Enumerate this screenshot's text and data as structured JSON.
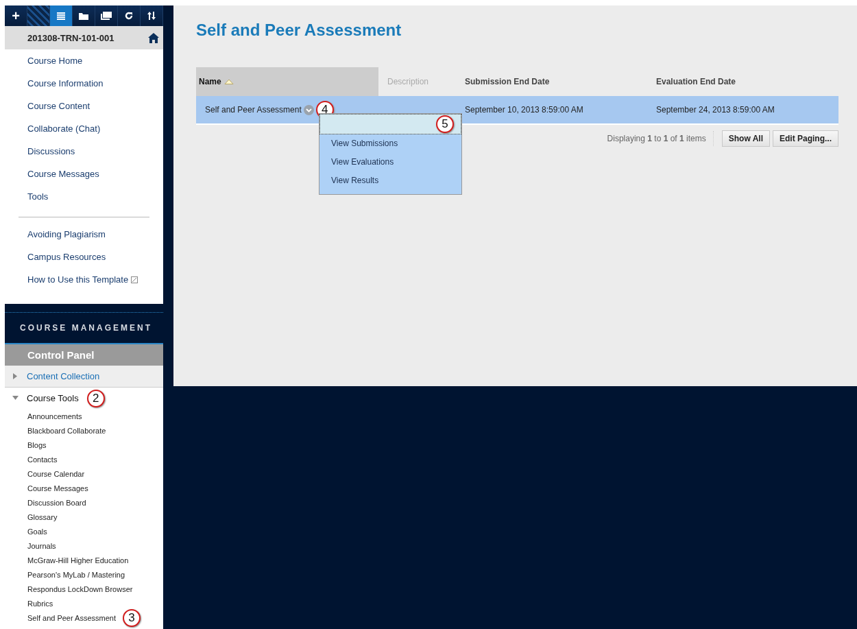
{
  "toolbar": [
    {
      "kind": "plus",
      "label": "+",
      "selected": false
    },
    {
      "kind": "pattern",
      "selected": false
    },
    {
      "kind": "list",
      "selected": true
    },
    {
      "kind": "folder",
      "selected": false
    },
    {
      "kind": "windows",
      "selected": false
    },
    {
      "kind": "refresh",
      "selected": false
    },
    {
      "kind": "sort",
      "selected": false
    }
  ],
  "course": {
    "title": "201308-TRN-101-001"
  },
  "menu": [
    {
      "label": "Course Home"
    },
    {
      "label": "Course Information"
    },
    {
      "label": "Course Content"
    },
    {
      "label": "Collaborate (Chat)"
    },
    {
      "label": "Discussions"
    },
    {
      "label": "Course Messages"
    },
    {
      "label": "Tools"
    }
  ],
  "extra_links": [
    {
      "label": "Avoiding Plagiarism",
      "external": false
    },
    {
      "label": "Campus Resources",
      "external": false
    },
    {
      "label": "How to Use this Template",
      "external": true
    }
  ],
  "management": {
    "heading": "COURSE MANAGEMENT",
    "control_panel": "Control Panel",
    "sections": [
      {
        "label": "Content Collection",
        "expanded": false
      },
      {
        "label": "Course Tools",
        "expanded": true,
        "callout": "2",
        "children": [
          {
            "label": "Announcements"
          },
          {
            "label": "Blackboard Collaborate"
          },
          {
            "label": "Blogs"
          },
          {
            "label": "Contacts"
          },
          {
            "label": "Course Calendar"
          },
          {
            "label": "Course Messages"
          },
          {
            "label": "Discussion Board"
          },
          {
            "label": "Glossary"
          },
          {
            "label": "Goals"
          },
          {
            "label": "Journals"
          },
          {
            "label": "McGraw-Hill Higher Education"
          },
          {
            "label": "Pearson's MyLab / Mastering"
          },
          {
            "label": "Respondus LockDown Browser"
          },
          {
            "label": "Rubrics"
          },
          {
            "label": "Self and Peer Assessment",
            "callout": "3"
          }
        ]
      }
    ]
  },
  "page": {
    "title": "Self and Peer Assessment",
    "table": {
      "columns": [
        {
          "label": "Name",
          "sorted": true,
          "disabled": false
        },
        {
          "label": "Description",
          "sorted": false,
          "disabled": true
        },
        {
          "label": "Submission End Date",
          "sorted": false,
          "disabled": false
        },
        {
          "label": "Evaluation End Date",
          "sorted": false,
          "disabled": false
        }
      ],
      "rows": [
        {
          "name": "Self and Peer Assessment",
          "callout": "4",
          "description": "",
          "submission": "September 10, 2013 8:59:00 AM",
          "evaluation": "September 24, 2013 8:59:00 AM",
          "selected": true
        }
      ]
    },
    "context_menu": {
      "callout": "5",
      "items": [
        {
          "label": "View Submissions"
        },
        {
          "label": "View Evaluations"
        },
        {
          "label": "View Results"
        }
      ]
    },
    "paging": {
      "text": "Displaying **1** to **1** of **1** items",
      "buttons": [
        "Show All",
        "Edit Paging..."
      ]
    }
  }
}
